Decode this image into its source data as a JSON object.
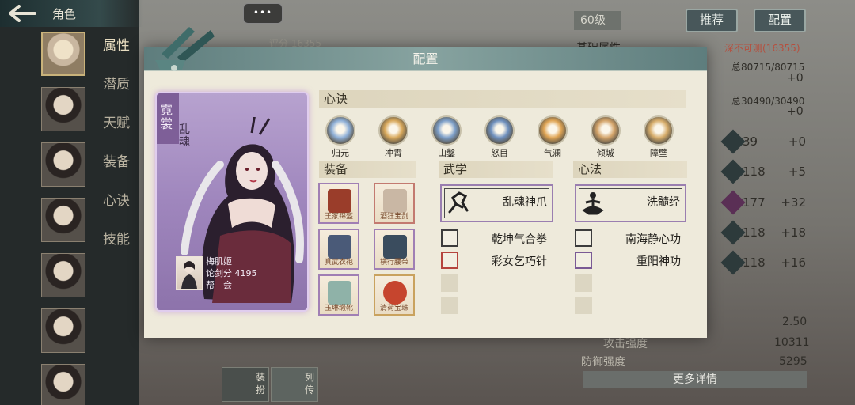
{
  "nav": {
    "title": "角色",
    "back_icon": "back-arrow-icon"
  },
  "side_tabs": [
    "属性",
    "潜质",
    "天赋",
    "装备",
    "心诀",
    "技能"
  ],
  "background": {
    "chat_icon": "•••",
    "score_label": "评分 16355",
    "level": "60级",
    "recommend_btn": "推荐",
    "config_btn": "配置",
    "base_attr_label": "基础属性",
    "deep_label": "深不可测(16355)",
    "hp": "总80715/80715",
    "hp_plus": "+0",
    "mp": "总30490/30490",
    "mp_plus": "+0",
    "stats": [
      {
        "value": "39",
        "plus": "+0"
      },
      {
        "value": "118",
        "plus": "+5"
      },
      {
        "value": "177",
        "plus": "+32"
      },
      {
        "value": "118",
        "plus": "+18"
      },
      {
        "value": "118",
        "plus": "+16"
      }
    ],
    "extra": [
      {
        "label": "",
        "value": "2.50"
      },
      {
        "label": "攻击强度",
        "value": "10311"
      },
      {
        "label": "防御强度",
        "value": "5295"
      }
    ],
    "more_btn": "更多详情",
    "bottom_tabs": [
      "装扮",
      "列传"
    ]
  },
  "dialog": {
    "title": "配置",
    "hero": {
      "name": "霓裳",
      "title": "乱魂",
      "owner_name": "梅肌姬",
      "owner_score": "论剑分 4195",
      "owner_guild": "帮　会"
    },
    "xinjue_label": "心诀",
    "xinjue": [
      {
        "label": "归元",
        "color": "#8fb0d8"
      },
      {
        "label": "冲霄",
        "color": "#d9a95c"
      },
      {
        "label": "山鑿",
        "color": "#7d9fc9"
      },
      {
        "label": "怒目",
        "color": "#6f90be"
      },
      {
        "label": "气澜",
        "color": "#e0a555"
      },
      {
        "label": "倾城",
        "color": "#d4a46a"
      },
      {
        "label": "障壁",
        "color": "#d7ad6b"
      }
    ],
    "equip_label": "装备",
    "equip": [
      {
        "name": "王家锦盔",
        "color": "#9a3d2a",
        "frame": "purple"
      },
      {
        "name": "酒狂宝剑",
        "color": "#c9b7a4",
        "frame": "red"
      },
      {
        "name": "真武衣袍",
        "color": "#4a5a78",
        "frame": "purple"
      },
      {
        "name": "横行腰带",
        "color": "#3a4c5e",
        "frame": "purple"
      },
      {
        "name": "玉琳缎靴",
        "color": "#8fb2a8",
        "frame": "purple"
      },
      {
        "name": "清荷宝珠",
        "color": "#c6452e",
        "frame": "gold"
      }
    ],
    "wuxue_label": "武学",
    "wuxue_main": "乱魂神爪",
    "wuxue_list": [
      {
        "name": "乾坤气合拳",
        "frame": "dark"
      },
      {
        "name": "彩女乞巧针",
        "frame": "red"
      }
    ],
    "xinfa_label": "心法",
    "xinfa_main": "洗髓经",
    "xinfa_list": [
      {
        "name": "南海静心功",
        "frame": "dark"
      },
      {
        "name": "重阳神功",
        "frame": "purple"
      }
    ]
  }
}
